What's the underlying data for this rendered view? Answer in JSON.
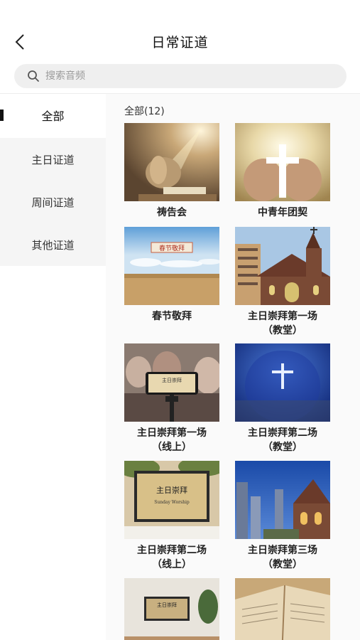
{
  "header": {
    "title": "日常证道",
    "back_icon": "back-chevron-icon"
  },
  "search": {
    "placeholder": "搜索音频",
    "icon": "search-icon"
  },
  "sidebar": {
    "items": [
      {
        "label": "全部",
        "active": true
      },
      {
        "label": "主日证道",
        "active": false
      },
      {
        "label": "周间证道",
        "active": false
      },
      {
        "label": "其他证道",
        "active": false
      }
    ]
  },
  "content": {
    "count_label": "全部(12)",
    "cards": [
      {
        "title": "祷告会",
        "subtitle": ""
      },
      {
        "title": "中青年团契",
        "subtitle": ""
      },
      {
        "title": "春节敬拜",
        "subtitle": "",
        "image_text": "春节敬拜"
      },
      {
        "title": "主日崇拜第一场",
        "subtitle": "（教堂）"
      },
      {
        "title": "主日崇拜第一场",
        "subtitle": "（线上）",
        "image_text": "主日崇拜"
      },
      {
        "title": "主日崇拜第二场",
        "subtitle": "（教堂）"
      },
      {
        "title": "主日崇拜第二场",
        "subtitle": "（线上）",
        "image_text": "主日崇拜",
        "image_subtext": "Sunday Worship"
      },
      {
        "title": "主日崇拜第三场",
        "subtitle": "（教堂）"
      },
      {
        "title": "",
        "subtitle": "",
        "image_text": "主日崇拜"
      },
      {
        "title": "",
        "subtitle": ""
      }
    ]
  }
}
